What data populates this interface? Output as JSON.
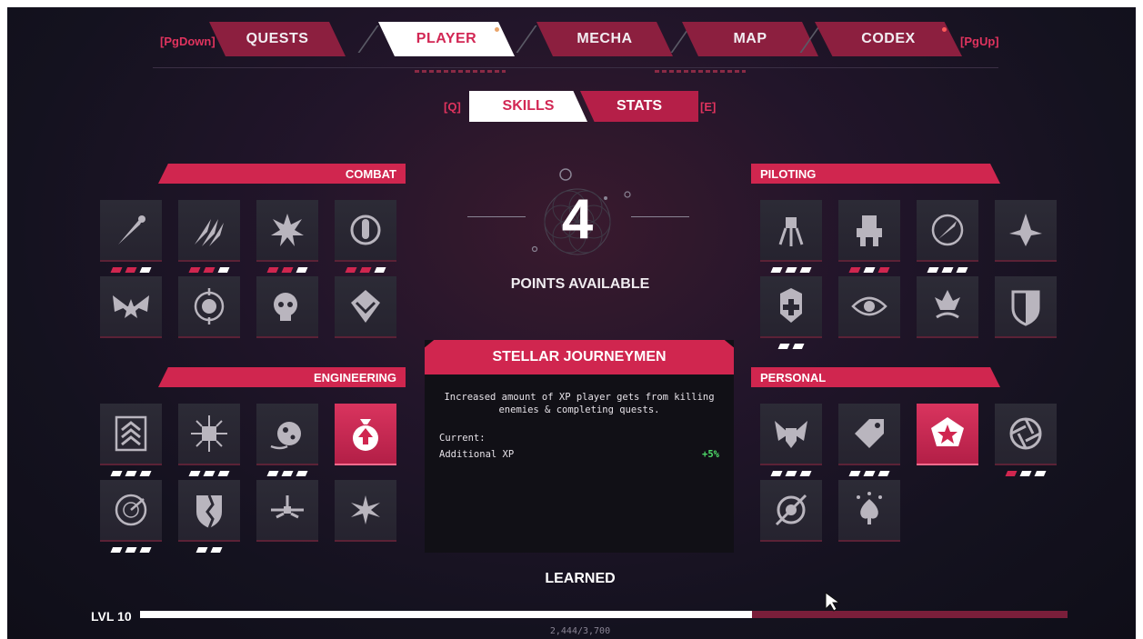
{
  "nav": {
    "prev_key": "[PgDown]",
    "next_key": "[PgUp]",
    "tabs": [
      "QUESTS",
      "PLAYER",
      "MECHA",
      "MAP",
      "CODEX"
    ],
    "active": "PLAYER"
  },
  "subnav": {
    "prev_key": "[Q]",
    "next_key": "[E]",
    "tabs": [
      "SKILLS",
      "STATS"
    ],
    "active": "SKILLS"
  },
  "sections": {
    "combat": "COMBAT",
    "piloting": "PILOTING",
    "engineering": "ENGINEERING",
    "personal": "PERSONAL"
  },
  "points": {
    "value": "4",
    "label": "POINTS AVAILABLE"
  },
  "skill_info": {
    "title": "STELLAR JOURNEYMEN",
    "description": "Increased amount of XP player gets from killing enemies & completing quests.",
    "current_label": "Current:",
    "stat_label": "Additional XP",
    "stat_value": "+5%"
  },
  "status": "LEARNED",
  "level": {
    "label": "LVL 10",
    "xp_text": "2,444/3,700",
    "progress": 0.66
  },
  "colors": {
    "accent": "#d0264f",
    "accent_dark": "#8c1f3f",
    "bonus": "#4fdc6a"
  },
  "skills": {
    "combat": [
      {
        "icon": "comet-icon",
        "pips": [
          "red",
          "red",
          "white"
        ]
      },
      {
        "icon": "claw-slash-icon",
        "pips": [
          "red",
          "red",
          "white"
        ]
      },
      {
        "icon": "explosion-icon",
        "pips": [
          "red",
          "red",
          "white"
        ]
      },
      {
        "icon": "bullet-reload-icon",
        "pips": [
          "red",
          "red",
          "white"
        ]
      },
      {
        "icon": "winged-star-icon",
        "pips": []
      },
      {
        "icon": "crosshair-skull-icon",
        "pips": []
      },
      {
        "icon": "fast-skull-icon",
        "pips": []
      },
      {
        "icon": "diamond-chevron-icon",
        "pips": []
      }
    ],
    "piloting": [
      {
        "icon": "mech-walker-icon",
        "pips": [
          "white",
          "white",
          "white"
        ]
      },
      {
        "icon": "mech-robot-icon",
        "pips": [
          "red",
          "white",
          "red"
        ]
      },
      {
        "icon": "target-rocket-icon",
        "pips": [
          "white",
          "white",
          "white"
        ]
      },
      {
        "icon": "ship-burst-icon",
        "pips": []
      },
      {
        "icon": "medic-badge-icon",
        "pips": [
          "white",
          "white"
        ]
      },
      {
        "icon": "eye-shield-icon",
        "pips": []
      },
      {
        "icon": "flame-crest-icon",
        "pips": []
      },
      {
        "icon": "armor-shield-icon",
        "pips": []
      }
    ],
    "engineering": [
      {
        "icon": "rank-chevrons-icon",
        "pips": [
          "white",
          "white",
          "white"
        ]
      },
      {
        "icon": "circuit-chip-icon",
        "pips": [
          "white",
          "white",
          "white"
        ]
      },
      {
        "icon": "asteroid-icon",
        "pips": [
          "white",
          "white",
          "white"
        ]
      },
      {
        "icon": "xp-bag-icon",
        "pips": [],
        "selected": true
      },
      {
        "icon": "radar-scan-icon",
        "pips": [
          "white",
          "white",
          "white"
        ]
      },
      {
        "icon": "split-shield-icon",
        "pips": [
          "white",
          "white"
        ]
      },
      {
        "icon": "drone-cross-icon",
        "pips": []
      },
      {
        "icon": "starburst-drone-icon",
        "pips": []
      }
    ],
    "personal": [
      {
        "icon": "winged-emblem-icon",
        "pips": [
          "white",
          "white",
          "white"
        ]
      },
      {
        "icon": "price-tag-icon",
        "pips": [
          "white",
          "white",
          "white"
        ]
      },
      {
        "icon": "star-crest-icon",
        "pips": [],
        "selected": true
      },
      {
        "icon": "portal-aperture-icon",
        "pips": [
          "red",
          "white",
          "white"
        ]
      },
      {
        "icon": "pierced-orb-icon",
        "pips": []
      },
      {
        "icon": "spade-stars-icon",
        "pips": []
      }
    ]
  }
}
